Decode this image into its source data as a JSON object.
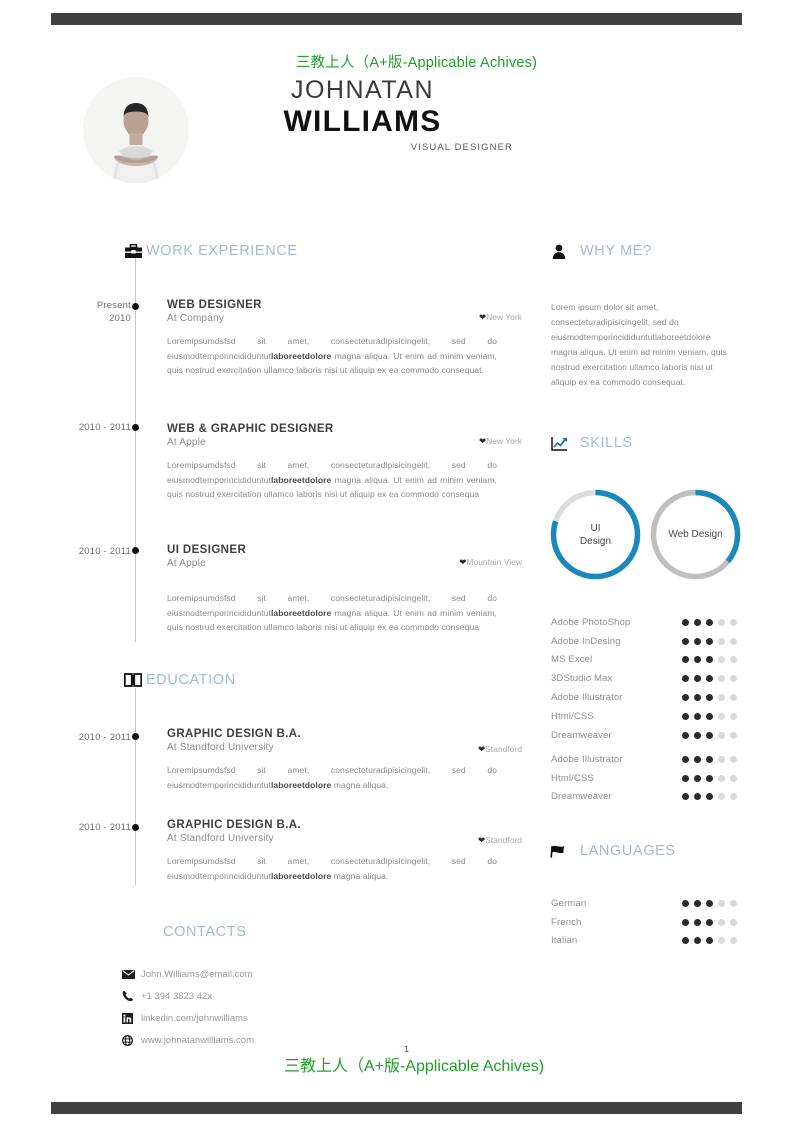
{
  "document": {
    "watermark_top": "三教上人（A+版-Applicable Achives)",
    "watermark_bottom": "三教上人（A+版-Applicable Achives)",
    "page_number": "1"
  },
  "header": {
    "first_name": "JOHNATAN",
    "last_name": "WILLIAMS",
    "job_title": "VISUAL DESIGNER",
    "photo_alt": "profile-photo"
  },
  "sections": {
    "work_experience": {
      "label": "WORK EXPERIENCE",
      "icon": "briefcase-icon"
    },
    "education": {
      "label": "EDUCATION",
      "icon": "book-icon"
    },
    "contacts": {
      "label": "CONTACTS"
    },
    "why_me": {
      "label": "WHY ME?",
      "icon": "person-icon"
    },
    "skills": {
      "label": "SKILLS",
      "icon": "chart-icon"
    },
    "languages": {
      "label": "LANGUAGES",
      "icon": "flag-icon"
    }
  },
  "work_experience": [
    {
      "date_line1": "Present",
      "date_line2": "2010",
      "title": "WEB DESIGNER",
      "company": "At Company",
      "location": "New York",
      "body_pre": "Loremipsumdsfsd sit amet, consecteturadipisicingelit, sed do eiusmodtemporincididuntut",
      "body_bold": "laboreetdolore",
      "body_post": " magna aliqua. Ut enim ad minim veniam, quis nostrud exercitation ullamco laboris nisi ut aliquip ex ea commodo consequat."
    },
    {
      "date_line1": "2010 - 2011",
      "date_line2": "",
      "title": "WEB & GRAPHIC DESIGNER",
      "company": "At Apple",
      "location": "New York",
      "body_pre": "Loremipsumdsfsd sit amet, consecteturadipisicingelit, sed do eiusmodtemporincididuntut",
      "body_bold": "laboreetdolore",
      "body_post": " magna aliqua. Ut enim ad minim veniam, quis nostrud exercitation ullamco laboris nisi ut aliquip ex ea commodo consequa"
    },
    {
      "date_line1": "2010 - 2011",
      "date_line2": "",
      "title": "UI DESIGNER",
      "company": "At Apple",
      "location": "Mountain View",
      "body_pre": "Loremipsumdsfsd sit amet, consecteturadipisicingelit, sed do eiusmodtemporincididuntut",
      "body_bold": "laboreetdolore",
      "body_post": " magna aliqua. Ut enim ad minim veniam, quis nostrud exercitation ullamco laboris nisi ut aliquip ex ea commodo consequa"
    }
  ],
  "education": [
    {
      "date_line1": "2010 - 2011",
      "title": "GRAPHIC DESIGN B.A.",
      "company": "At Standford University",
      "location": "Standford",
      "body_pre": "Loremipsumdsfsd sit amet, consecteturadipisicingelit, sed do eiusmodtemporincididuntut",
      "body_bold": "laboreetdolore",
      "body_post": " magna aliqua."
    },
    {
      "date_line1": "2010 - 2011",
      "title": "GRAPHIC DESIGN B.A.",
      "company": "At Standford University",
      "location": "Standford",
      "body_pre": "Loremipsumdsfsd sit amet, consecteturadipisicingelit, sed do eiusmodtemporincididuntut",
      "body_bold": "laboreetdolore",
      "body_post": " magna aliqua."
    }
  ],
  "contacts": [
    {
      "icon": "envelope-icon",
      "value": "John.Williams@email.com"
    },
    {
      "icon": "phone-icon",
      "value": "+1 394 3823 42x"
    },
    {
      "icon": "linkedin-icon",
      "value": "linkedin.com/johnwilliams"
    },
    {
      "icon": "globe-icon",
      "value": "www.johnatanwilliams.com"
    }
  ],
  "why_me": {
    "body": "Lorem ipsum dolor sit amet, consecteturadipisicingelit, sed do eiusmodtemporincididuntutlaboreetdolore magna aliqua. Ut enim ad minim veniam, quis nostrud exercitation ullamco laboris nisi ut aliquip ex ea commodo consequat."
  },
  "chart_data": {
    "type": "pie",
    "title": "SKILLS",
    "rings": [
      {
        "label": "UI\nDesign",
        "label_line1": "UI",
        "label_line2": "Design",
        "value": 80,
        "max": 100,
        "color": "#1a87bd",
        "track": "#dcdcdc"
      },
      {
        "label": "Web Design",
        "label_line1": "Web Design",
        "label_line2": "",
        "value": 36,
        "max": 100,
        "color": "#1a87bd",
        "track": "#bfbfbf"
      }
    ]
  },
  "skill_ratings_primary": [
    {
      "name": "Adobe PhotoShop",
      "value": 3,
      "max": 5
    },
    {
      "name": "Adobe InDesing",
      "value": 3,
      "max": 5
    },
    {
      "name": "MS Excel",
      "value": 3,
      "max": 5
    },
    {
      "name": "3DStudio Max",
      "value": 3,
      "max": 5
    },
    {
      "name": "Adobe Illustrator",
      "value": 3,
      "max": 5
    },
    {
      "name": "Html/CSS",
      "value": 3,
      "max": 5
    },
    {
      "name": "Dreamweaver",
      "value": 3,
      "max": 5
    }
  ],
  "skill_ratings_secondary": [
    {
      "name": "Adobe Illustrator",
      "value": 3,
      "max": 5
    },
    {
      "name": "Html/CSS",
      "value": 3,
      "max": 5
    },
    {
      "name": "Dreamweaver",
      "value": 3,
      "max": 5
    }
  ],
  "languages": [
    {
      "name": "German",
      "value": 3,
      "max": 5
    },
    {
      "name": "French",
      "value": 3,
      "max": 5
    },
    {
      "name": "Italian",
      "value": 3,
      "max": 5
    }
  ],
  "colors": {
    "accent_blue": "#1a87bd",
    "heading_blue": "#9fbcd4",
    "watermark_green": "#21a02a",
    "rule_dark": "#404040",
    "dot_on": "#2b2b2b",
    "dot_off": "#d9d9d9"
  }
}
